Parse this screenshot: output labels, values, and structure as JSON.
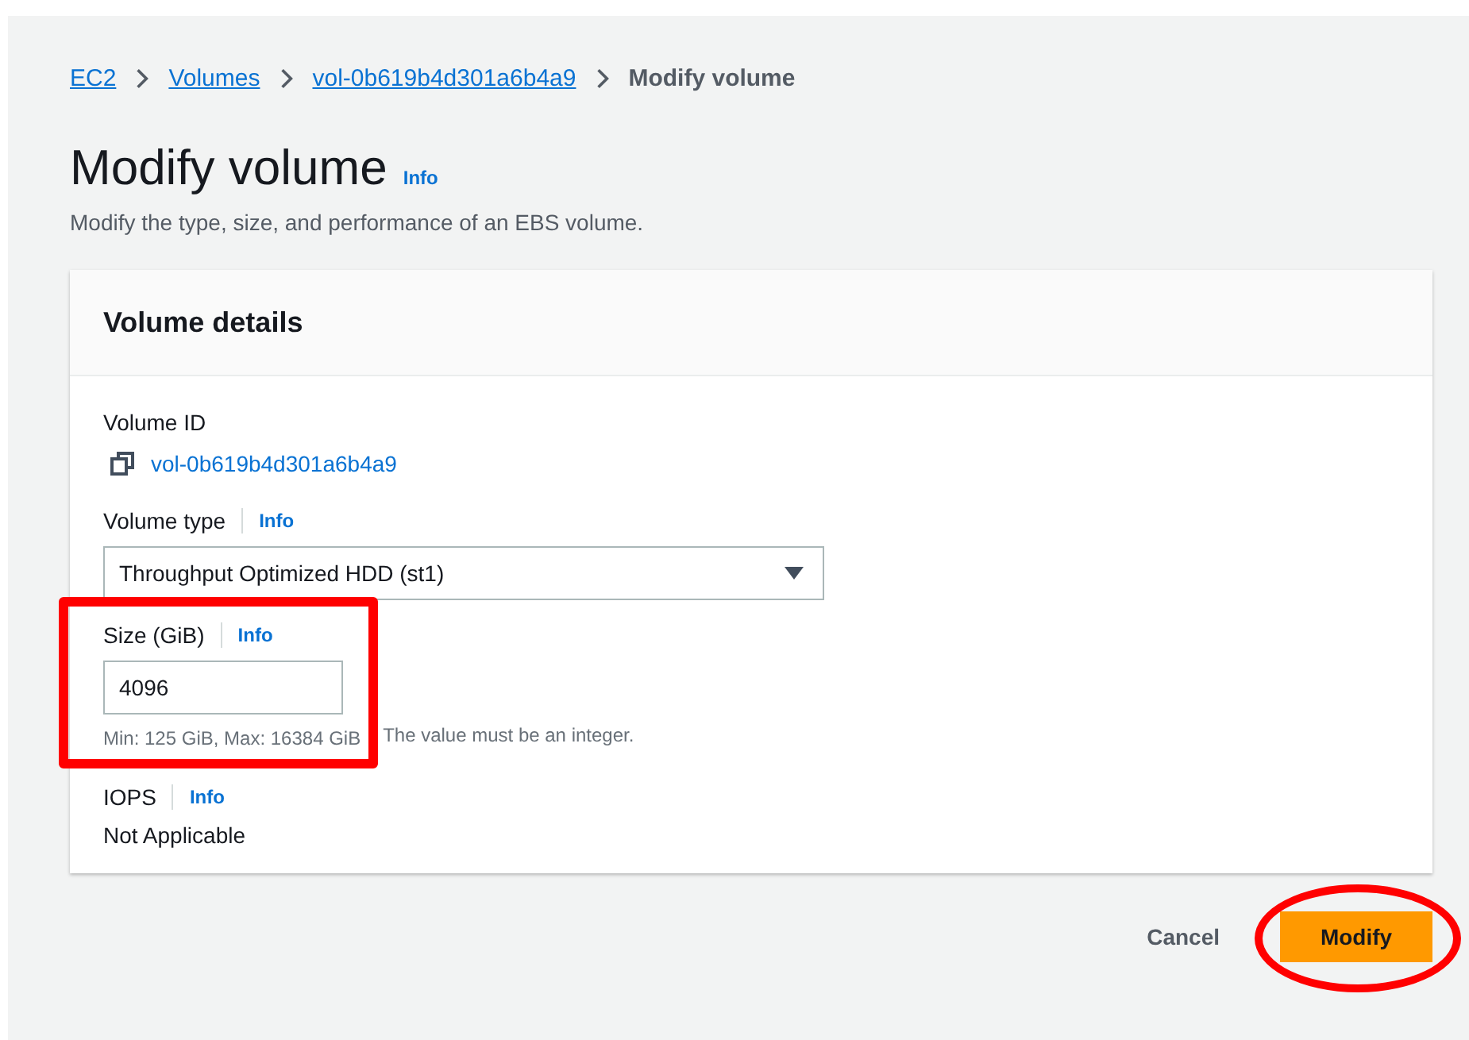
{
  "breadcrumbs": [
    {
      "label": "EC2",
      "link": true
    },
    {
      "label": "Volumes",
      "link": true
    },
    {
      "label": "vol-0b619b4d301a6b4a9",
      "link": true
    },
    {
      "label": "Modify volume",
      "link": false
    }
  ],
  "page": {
    "title": "Modify volume",
    "info": "Info",
    "description": "Modify the type, size, and performance of an EBS volume."
  },
  "card": {
    "title": "Volume details",
    "volume_id": {
      "label": "Volume ID",
      "value": "vol-0b619b4d301a6b4a9"
    },
    "volume_type": {
      "label": "Volume type",
      "info": "Info",
      "value": "Throughput Optimized HDD (st1)"
    },
    "size": {
      "label": "Size (GiB)",
      "info": "Info",
      "value": "4096",
      "hint_start": "Min: 125 GiB, Max: 16384 GiB",
      "hint_end": "The value must be an integer.",
      "highlighted": true
    },
    "iops": {
      "label": "IOPS",
      "info": "Info",
      "value": "Not Applicable"
    }
  },
  "buttons": {
    "cancel": "Cancel",
    "modify": "Modify",
    "modify_highlighted": true
  }
}
